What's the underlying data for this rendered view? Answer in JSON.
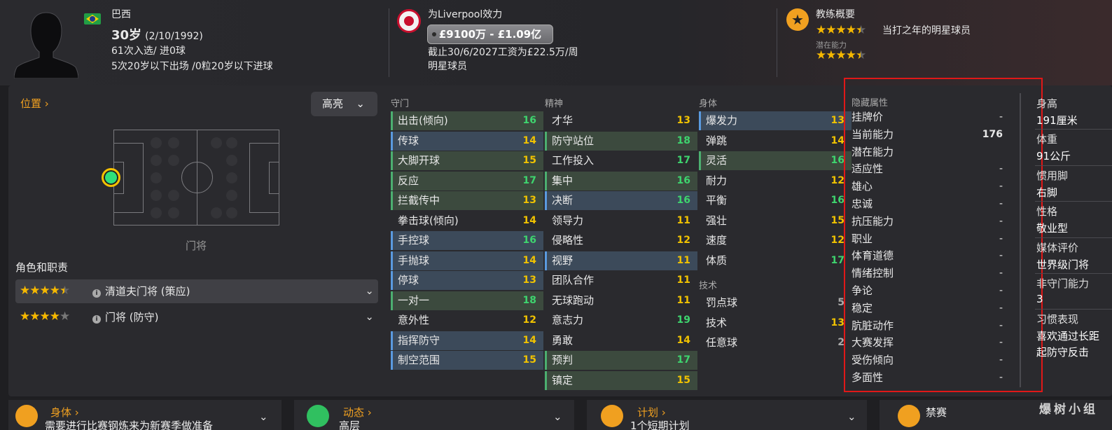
{
  "header": {
    "player_name": "巴西",
    "age": "30岁",
    "dob": "(2/10/1992)",
    "caps": "61次入选/ 进0球",
    "u20": "5次20岁以下出场 /0粒20岁以下进球",
    "club_line": "为Liverpool效力",
    "value": "£9100万 - £1.09亿",
    "contract": "截止30/6/2027工资为£22.5万/周",
    "status": "明星球员",
    "coach_title": "教练概要",
    "coach_desc": "当打之年的明星球员",
    "potential_label": "潜在能力",
    "current_stars": 4.5,
    "potential_stars": 4.5
  },
  "left": {
    "position_link": "位置",
    "highlight_dropdown": "高亮",
    "position_label": "门将",
    "roles_title": "角色和职责",
    "roles": [
      {
        "name": "清道夫门将 (策应)",
        "stars": 4.5
      },
      {
        "name": "门将 (防守)",
        "stars": 4
      }
    ]
  },
  "columns": {
    "goalkeeping": {
      "title": "守门",
      "attrs": [
        {
          "name": "出击(倾向)",
          "value": "16",
          "hl": "green",
          "c": "g"
        },
        {
          "name": "传球",
          "value": "14",
          "hl": "blue",
          "c": "y"
        },
        {
          "name": "大脚开球",
          "value": "15",
          "hl": "green",
          "c": "y"
        },
        {
          "name": "反应",
          "value": "17",
          "hl": "green",
          "c": "g"
        },
        {
          "name": "拦截传中",
          "value": "13",
          "hl": "green",
          "c": "y"
        },
        {
          "name": "拳击球(倾向)",
          "value": "14",
          "hl": "",
          "c": "y"
        },
        {
          "name": "手控球",
          "value": "16",
          "hl": "blue",
          "c": "g"
        },
        {
          "name": "手抛球",
          "value": "14",
          "hl": "blue",
          "c": "y"
        },
        {
          "name": "停球",
          "value": "13",
          "hl": "blue",
          "c": "y"
        },
        {
          "name": "一对一",
          "value": "18",
          "hl": "green",
          "c": "g"
        },
        {
          "name": "意外性",
          "value": "12",
          "hl": "",
          "c": "y"
        },
        {
          "name": "指挥防守",
          "value": "14",
          "hl": "blue",
          "c": "y"
        },
        {
          "name": "制空范围",
          "value": "15",
          "hl": "blue",
          "c": "y"
        }
      ]
    },
    "mental": {
      "title": "精神",
      "attrs": [
        {
          "name": "才华",
          "value": "13",
          "hl": "",
          "c": "y"
        },
        {
          "name": "防守站位",
          "value": "18",
          "hl": "green",
          "c": "g"
        },
        {
          "name": "工作投入",
          "value": "17",
          "hl": "",
          "c": "g"
        },
        {
          "name": "集中",
          "value": "16",
          "hl": "green",
          "c": "g"
        },
        {
          "name": "决断",
          "value": "16",
          "hl": "blue",
          "c": "g"
        },
        {
          "name": "领导力",
          "value": "11",
          "hl": "",
          "c": "y"
        },
        {
          "name": "侵略性",
          "value": "12",
          "hl": "",
          "c": "y"
        },
        {
          "name": "视野",
          "value": "11",
          "hl": "blue",
          "c": "y"
        },
        {
          "name": "团队合作",
          "value": "11",
          "hl": "",
          "c": "y"
        },
        {
          "name": "无球跑动",
          "value": "11",
          "hl": "",
          "c": "y"
        },
        {
          "name": "意志力",
          "value": "19",
          "hl": "",
          "c": "g"
        },
        {
          "name": "勇敢",
          "value": "14",
          "hl": "",
          "c": "y"
        },
        {
          "name": "预判",
          "value": "17",
          "hl": "green",
          "c": "g"
        },
        {
          "name": "镇定",
          "value": "15",
          "hl": "green",
          "c": "y"
        }
      ]
    },
    "physical": {
      "title": "身体",
      "attrs": [
        {
          "name": "爆发力",
          "value": "13",
          "hl": "blue",
          "c": "y"
        },
        {
          "name": "弹跳",
          "value": "14",
          "hl": "",
          "c": "y"
        },
        {
          "name": "灵活",
          "value": "16",
          "hl": "green",
          "c": "g"
        },
        {
          "name": "耐力",
          "value": "12",
          "hl": "",
          "c": "y"
        },
        {
          "name": "平衡",
          "value": "16",
          "hl": "",
          "c": "g"
        },
        {
          "name": "强壮",
          "value": "15",
          "hl": "",
          "c": "y"
        },
        {
          "name": "速度",
          "value": "12",
          "hl": "",
          "c": "y"
        },
        {
          "name": "体质",
          "value": "17",
          "hl": "",
          "c": "g"
        }
      ]
    },
    "technical": {
      "title": "技术",
      "attrs": [
        {
          "name": "罚点球",
          "value": "5",
          "hl": "",
          "c": "gr"
        },
        {
          "name": "技术",
          "value": "13",
          "hl": "",
          "c": "y"
        },
        {
          "name": "任意球",
          "value": "2",
          "hl": "",
          "c": "gr"
        }
      ]
    }
  },
  "hidden": {
    "title": "隐藏属性",
    "rows": [
      {
        "name": "挂牌价",
        "value": "-"
      },
      {
        "name": "当前能力",
        "value": "176"
      },
      {
        "name": "潜在能力",
        "value": ""
      },
      {
        "name": "适应性",
        "value": "-"
      },
      {
        "name": "雄心",
        "value": "-"
      },
      {
        "name": "忠诚",
        "value": "-"
      },
      {
        "name": "抗压能力",
        "value": "-"
      },
      {
        "name": "职业",
        "value": "-"
      },
      {
        "name": "体育道德",
        "value": "-"
      },
      {
        "name": "情绪控制",
        "value": "-"
      },
      {
        "name": "争论",
        "value": "-"
      },
      {
        "name": "稳定",
        "value": "-"
      },
      {
        "name": "肮脏动作",
        "value": "-"
      },
      {
        "name": "大赛发挥",
        "value": "-"
      },
      {
        "name": "受伤倾向",
        "value": "-"
      },
      {
        "name": "多面性",
        "value": "-"
      }
    ]
  },
  "info": {
    "height_label": "身高",
    "height": "191厘米",
    "weight_label": "体重",
    "weight": "91公斤",
    "foot_label": "惯用脚",
    "foot": "右脚",
    "personality_label": "性格",
    "personality": "敬业型",
    "media_label": "媒体评价",
    "media": "世界级门将",
    "ngk_label": "非守门能力",
    "ngk": "3",
    "habits_label": "习惯表现",
    "habit1": "喜欢通过长距",
    "habit2": "起防守反击"
  },
  "bottom": {
    "fitness_label": "身体",
    "fitness_text": "需要进行比赛钢炼来为新赛季做准备",
    "dynamics_label": "动态",
    "dynamics_text": "高层",
    "plan_label": "计划",
    "plan_text": "1个短期计划",
    "ban_label": "禁赛"
  },
  "watermark": "爆树小组"
}
